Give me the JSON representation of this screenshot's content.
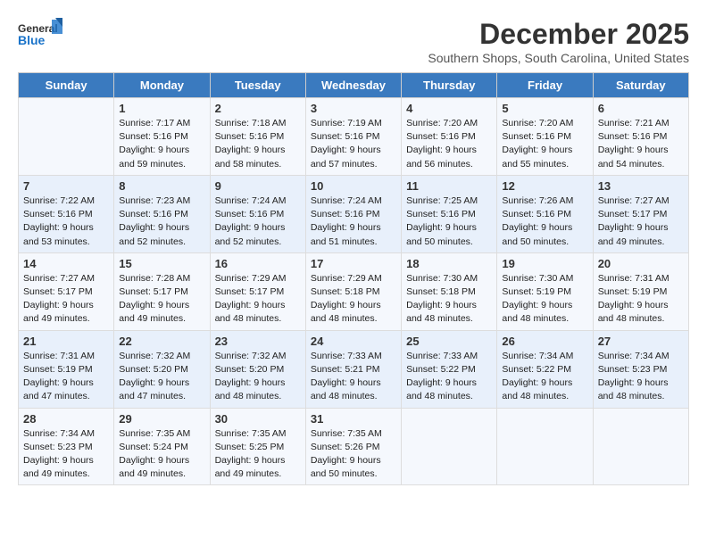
{
  "header": {
    "logo_line1": "General",
    "logo_line2": "Blue",
    "title": "December 2025",
    "location": "Southern Shops, South Carolina, United States"
  },
  "days_of_week": [
    "Sunday",
    "Monday",
    "Tuesday",
    "Wednesday",
    "Thursday",
    "Friday",
    "Saturday"
  ],
  "weeks": [
    [
      {
        "day": "",
        "detail": ""
      },
      {
        "day": "1",
        "detail": "Sunrise: 7:17 AM\nSunset: 5:16 PM\nDaylight: 9 hours\nand 59 minutes."
      },
      {
        "day": "2",
        "detail": "Sunrise: 7:18 AM\nSunset: 5:16 PM\nDaylight: 9 hours\nand 58 minutes."
      },
      {
        "day": "3",
        "detail": "Sunrise: 7:19 AM\nSunset: 5:16 PM\nDaylight: 9 hours\nand 57 minutes."
      },
      {
        "day": "4",
        "detail": "Sunrise: 7:20 AM\nSunset: 5:16 PM\nDaylight: 9 hours\nand 56 minutes."
      },
      {
        "day": "5",
        "detail": "Sunrise: 7:20 AM\nSunset: 5:16 PM\nDaylight: 9 hours\nand 55 minutes."
      },
      {
        "day": "6",
        "detail": "Sunrise: 7:21 AM\nSunset: 5:16 PM\nDaylight: 9 hours\nand 54 minutes."
      }
    ],
    [
      {
        "day": "7",
        "detail": "Sunrise: 7:22 AM\nSunset: 5:16 PM\nDaylight: 9 hours\nand 53 minutes."
      },
      {
        "day": "8",
        "detail": "Sunrise: 7:23 AM\nSunset: 5:16 PM\nDaylight: 9 hours\nand 52 minutes."
      },
      {
        "day": "9",
        "detail": "Sunrise: 7:24 AM\nSunset: 5:16 PM\nDaylight: 9 hours\nand 52 minutes."
      },
      {
        "day": "10",
        "detail": "Sunrise: 7:24 AM\nSunset: 5:16 PM\nDaylight: 9 hours\nand 51 minutes."
      },
      {
        "day": "11",
        "detail": "Sunrise: 7:25 AM\nSunset: 5:16 PM\nDaylight: 9 hours\nand 50 minutes."
      },
      {
        "day": "12",
        "detail": "Sunrise: 7:26 AM\nSunset: 5:16 PM\nDaylight: 9 hours\nand 50 minutes."
      },
      {
        "day": "13",
        "detail": "Sunrise: 7:27 AM\nSunset: 5:17 PM\nDaylight: 9 hours\nand 49 minutes."
      }
    ],
    [
      {
        "day": "14",
        "detail": "Sunrise: 7:27 AM\nSunset: 5:17 PM\nDaylight: 9 hours\nand 49 minutes."
      },
      {
        "day": "15",
        "detail": "Sunrise: 7:28 AM\nSunset: 5:17 PM\nDaylight: 9 hours\nand 49 minutes."
      },
      {
        "day": "16",
        "detail": "Sunrise: 7:29 AM\nSunset: 5:17 PM\nDaylight: 9 hours\nand 48 minutes."
      },
      {
        "day": "17",
        "detail": "Sunrise: 7:29 AM\nSunset: 5:18 PM\nDaylight: 9 hours\nand 48 minutes."
      },
      {
        "day": "18",
        "detail": "Sunrise: 7:30 AM\nSunset: 5:18 PM\nDaylight: 9 hours\nand 48 minutes."
      },
      {
        "day": "19",
        "detail": "Sunrise: 7:30 AM\nSunset: 5:19 PM\nDaylight: 9 hours\nand 48 minutes."
      },
      {
        "day": "20",
        "detail": "Sunrise: 7:31 AM\nSunset: 5:19 PM\nDaylight: 9 hours\nand 48 minutes."
      }
    ],
    [
      {
        "day": "21",
        "detail": "Sunrise: 7:31 AM\nSunset: 5:19 PM\nDaylight: 9 hours\nand 47 minutes."
      },
      {
        "day": "22",
        "detail": "Sunrise: 7:32 AM\nSunset: 5:20 PM\nDaylight: 9 hours\nand 47 minutes."
      },
      {
        "day": "23",
        "detail": "Sunrise: 7:32 AM\nSunset: 5:20 PM\nDaylight: 9 hours\nand 48 minutes."
      },
      {
        "day": "24",
        "detail": "Sunrise: 7:33 AM\nSunset: 5:21 PM\nDaylight: 9 hours\nand 48 minutes."
      },
      {
        "day": "25",
        "detail": "Sunrise: 7:33 AM\nSunset: 5:22 PM\nDaylight: 9 hours\nand 48 minutes."
      },
      {
        "day": "26",
        "detail": "Sunrise: 7:34 AM\nSunset: 5:22 PM\nDaylight: 9 hours\nand 48 minutes."
      },
      {
        "day": "27",
        "detail": "Sunrise: 7:34 AM\nSunset: 5:23 PM\nDaylight: 9 hours\nand 48 minutes."
      }
    ],
    [
      {
        "day": "28",
        "detail": "Sunrise: 7:34 AM\nSunset: 5:23 PM\nDaylight: 9 hours\nand 49 minutes."
      },
      {
        "day": "29",
        "detail": "Sunrise: 7:35 AM\nSunset: 5:24 PM\nDaylight: 9 hours\nand 49 minutes."
      },
      {
        "day": "30",
        "detail": "Sunrise: 7:35 AM\nSunset: 5:25 PM\nDaylight: 9 hours\nand 49 minutes."
      },
      {
        "day": "31",
        "detail": "Sunrise: 7:35 AM\nSunset: 5:26 PM\nDaylight: 9 hours\nand 50 minutes."
      },
      {
        "day": "",
        "detail": ""
      },
      {
        "day": "",
        "detail": ""
      },
      {
        "day": "",
        "detail": ""
      }
    ]
  ]
}
